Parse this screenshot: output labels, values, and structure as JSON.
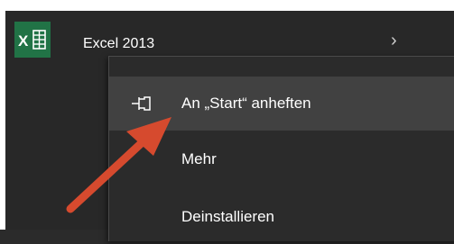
{
  "app": {
    "name": "Excel 2013",
    "icon": "excel-icon",
    "tile_color": "#217346",
    "expand_icon": "chevron-right-icon"
  },
  "context_menu": {
    "items": [
      {
        "label": "An „Start“ anheften",
        "icon": "pin-icon",
        "highlighted": true
      },
      {
        "label": "Mehr"
      },
      {
        "label": "Deinstallieren"
      }
    ]
  },
  "annotation": {
    "icon": "red-arrow-icon",
    "color": "#d64a2e"
  }
}
